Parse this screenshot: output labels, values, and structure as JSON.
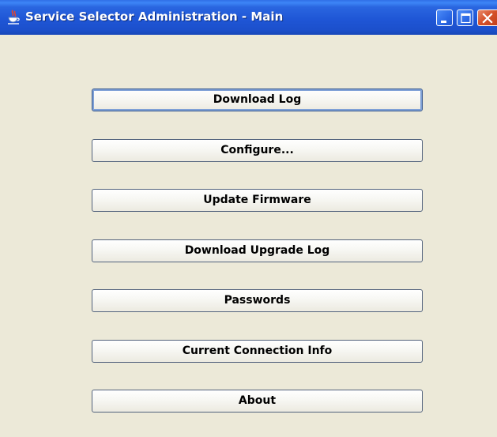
{
  "window": {
    "title": "Service Selector Administration - Main",
    "app_icon": "java-icon",
    "controls": {
      "minimize_icon": "minimize-icon",
      "maximize_icon": "maximize-icon",
      "close_icon": "close-icon"
    }
  },
  "menu": {
    "buttons": [
      {
        "id": "download-log",
        "label": "Download Log"
      },
      {
        "id": "configure",
        "label": "Configure..."
      },
      {
        "id": "update-firmware",
        "label": "Update Firmware"
      },
      {
        "id": "download-upgrade-log",
        "label": "Download Upgrade Log"
      },
      {
        "id": "passwords",
        "label": "Passwords"
      },
      {
        "id": "current-connection-info",
        "label": "Current Connection Info"
      },
      {
        "id": "about",
        "label": "About"
      }
    ]
  },
  "colors": {
    "titlebar": "#1f56d6",
    "client_background": "#ece9d8",
    "button_border": "#52627c",
    "close_button": "#d5502a"
  }
}
